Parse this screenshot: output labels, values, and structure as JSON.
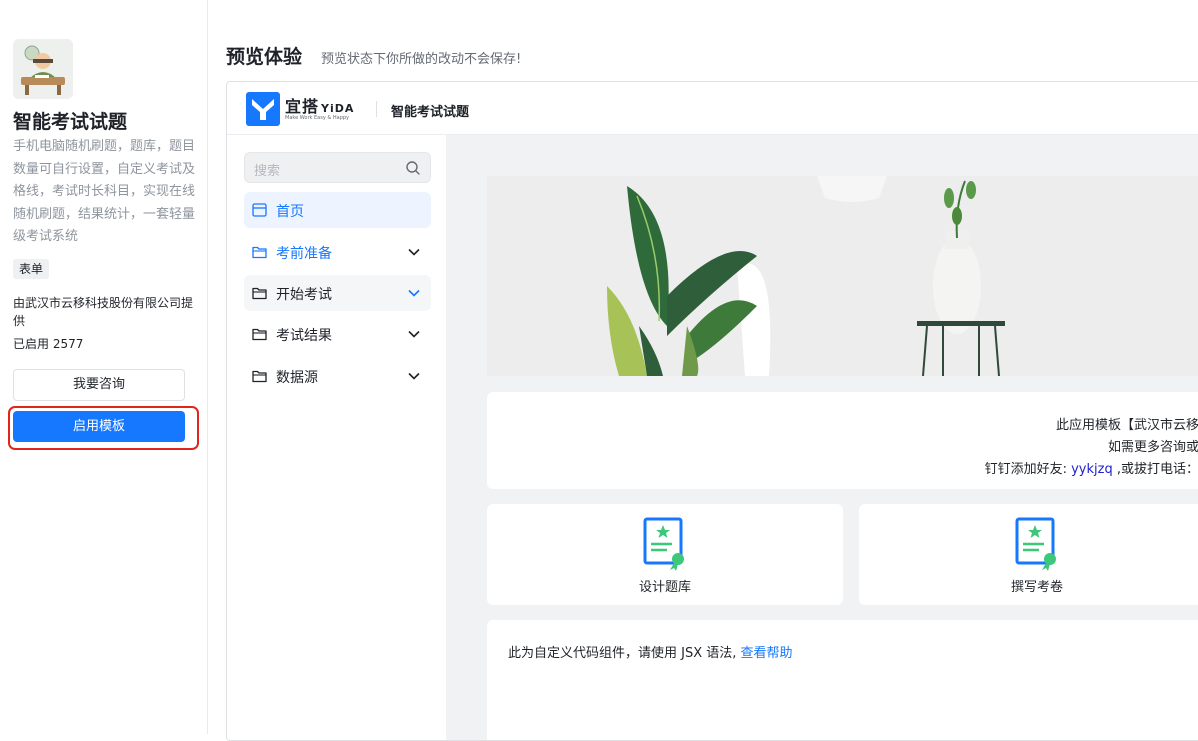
{
  "app": {
    "name": "智能考试试题",
    "description": "手机电脑随机刷题，题库，题目数量可自行设置，自定义考试及格线，考试时长科目，实现在线随机刷题，结果统计，一套轻量级考试系统",
    "tag": "表单",
    "provider": "由武汉市云移科技股份有限公司提供",
    "usage_label": "已启用",
    "usage_count": "2577",
    "consult_button": "我要咨询",
    "use_button": "启用模板"
  },
  "preview": {
    "title": "预览体验",
    "subtitle": "预览状态下你所做的改动不会保存!"
  },
  "topbar": {
    "brand": "宜搭",
    "brand_en": "YiDA",
    "brand_tagline": "Make Work Easy & Happy",
    "app_title": "智能考试试题"
  },
  "sidebar": {
    "search_placeholder": "搜索",
    "items": [
      {
        "label": "首页",
        "icon": "page-icon",
        "active": true
      },
      {
        "label": "考前准备",
        "icon": "folder-icon"
      },
      {
        "label": "开始考试",
        "icon": "folder-icon"
      },
      {
        "label": "考试结果",
        "icon": "folder-icon"
      },
      {
        "label": "数据源",
        "icon": "folder-icon"
      }
    ]
  },
  "notice": {
    "line1": "此应用模板【武汉市云移",
    "line2": "如需更多咨询或",
    "line3_prefix": "钉钉添加好友:",
    "line3_id": "yykjzq",
    "line3_suffix": ",或拔打电话："
  },
  "tiles": [
    {
      "label": "设计题库",
      "icon": "certificate-icon"
    },
    {
      "label": "撰写考卷",
      "icon": "certificate-icon"
    }
  ],
  "code_card": {
    "text": "此为自定义代码组件，请使用 JSX 语法,",
    "link": "查看帮助"
  },
  "colors": {
    "primary": "#1677ff",
    "highlight_border": "#e1251b",
    "tile_icon_blue": "#1677ff",
    "tile_icon_green": "#3cc77a"
  }
}
